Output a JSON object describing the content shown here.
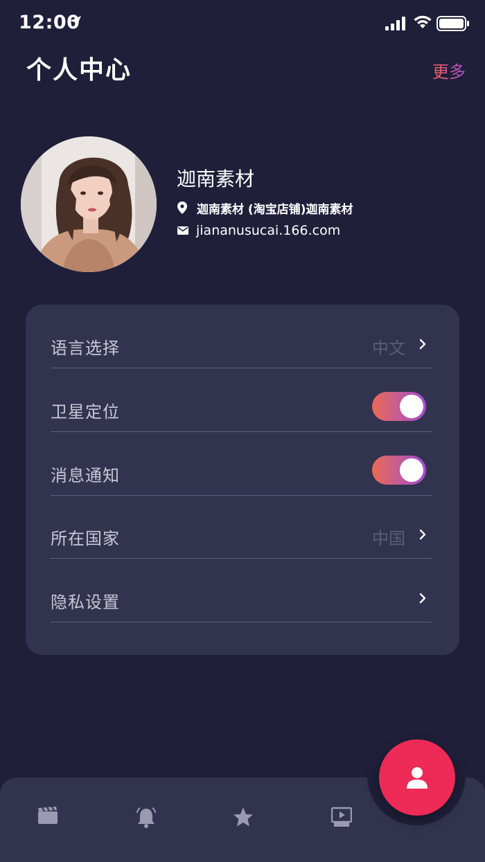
{
  "status_bar": {
    "time": "12:00"
  },
  "header": {
    "title": "个人中心",
    "more_label": "更多"
  },
  "profile": {
    "name": "迦南素材",
    "shop": "迦南素材 (淘宝店铺)迦南素材",
    "email": "jiananusucai.166.com"
  },
  "settings": {
    "rows": [
      {
        "label": "语言选择",
        "value": "中文",
        "control": "chevron"
      },
      {
        "label": "卫星定位",
        "control": "toggle",
        "enabled": true
      },
      {
        "label": "消息通知",
        "control": "toggle",
        "enabled": true
      },
      {
        "label": "所在国家",
        "value": "中国",
        "control": "chevron"
      },
      {
        "label": "隐私设置",
        "control": "chevron"
      }
    ]
  },
  "bottom_nav": {
    "items": [
      "film-icon",
      "bell-icon",
      "star-icon",
      "presentation-icon"
    ],
    "active": "profile-icon"
  },
  "colors": {
    "background": "#1f1f3a",
    "card": "#32334f",
    "accent_start": "#ea6a55",
    "accent_end": "#a14dd6",
    "fab": "#ee2a56"
  }
}
